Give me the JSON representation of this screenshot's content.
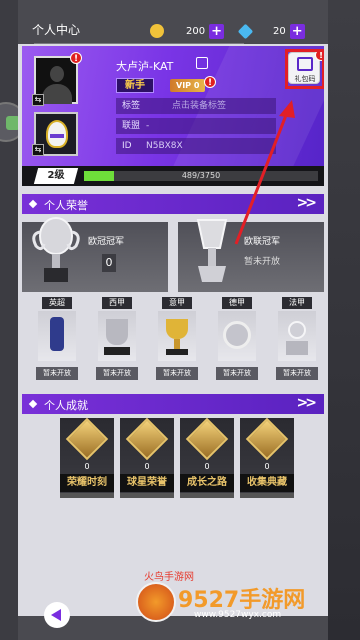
{
  "header": {
    "title": "个人中心",
    "currency_coin": "200",
    "currency_gem": "20",
    "plus": "+"
  },
  "profile": {
    "name": "大卢泸-KAT",
    "rank_badge": "新手",
    "vip_label": "VIP 0",
    "tag_label": "标签",
    "tag_placeholder": "点击装备标签",
    "league_label": "联盟",
    "league_value": "-",
    "id_label": "ID",
    "id_value": "N5BX8X",
    "gift_code_label": "礼包码",
    "alert_mark": "!"
  },
  "level": {
    "label": "2级",
    "xp_text": "489/3750",
    "progress": 0.13
  },
  "honors": {
    "section_title": "个人荣誉",
    "more": ">>",
    "cards": [
      {
        "name": "欧冠冠军",
        "count": "0"
      },
      {
        "name": "欧联冠军",
        "status": "暂未开放"
      }
    ],
    "leagues": [
      {
        "tag": "英超",
        "status": "暂未开放"
      },
      {
        "tag": "西甲",
        "status": "暂未开放"
      },
      {
        "tag": "意甲",
        "status": "暂未开放"
      },
      {
        "tag": "德甲",
        "status": "暂未开放"
      },
      {
        "tag": "法甲",
        "status": "暂未开放"
      }
    ]
  },
  "achievements": {
    "section_title": "个人成就",
    "more": ">>",
    "items": [
      {
        "label": "荣耀时刻",
        "count": "0"
      },
      {
        "label": "球星荣誉",
        "count": "0"
      },
      {
        "label": "成长之路",
        "count": "0"
      },
      {
        "label": "收集典藏",
        "count": "0"
      }
    ]
  },
  "watermark": {
    "small": "火鸟手游网",
    "big": "9527手游网",
    "url": "www.9527wyx.com"
  },
  "colors": {
    "accent": "#7a2de0",
    "highlight_box": "#e21f26",
    "xp_fill": "#6ede3a"
  }
}
